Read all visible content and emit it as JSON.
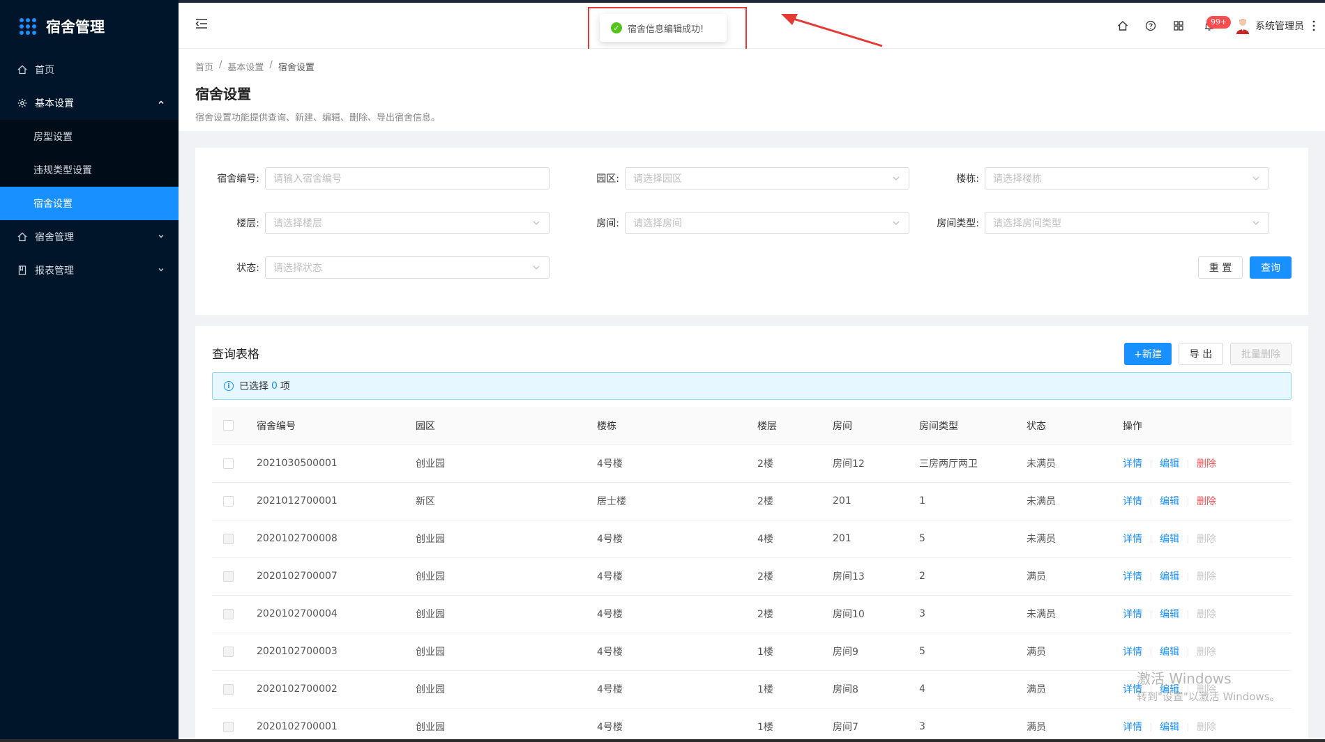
{
  "app": {
    "title": "宿舍管理"
  },
  "sidebar": {
    "items": [
      {
        "label": "首页",
        "icon": "home-icon"
      },
      {
        "label": "基本设置",
        "icon": "gear-icon",
        "open": true,
        "children": [
          {
            "label": "房型设置"
          },
          {
            "label": "违规类型设置"
          },
          {
            "label": "宿舍设置",
            "active": true
          }
        ]
      },
      {
        "label": "宿舍管理",
        "icon": "home-icon"
      },
      {
        "label": "报表管理",
        "icon": "document-icon"
      }
    ]
  },
  "header": {
    "badge": "99+",
    "user": "系统管理员",
    "icons": [
      "home-icon",
      "help-icon",
      "grid-icon",
      "bell-icon",
      "more-icon"
    ]
  },
  "toast": {
    "message": "宿舍信息编辑成功!"
  },
  "page": {
    "breadcrumb": [
      "首页",
      "基本设置",
      "宿舍设置"
    ],
    "breadcrumb_sep": "/",
    "title": "宿舍设置",
    "description": "宿舍设置功能提供查询、新建、编辑、删除、导出宿舍信息。"
  },
  "search": {
    "fields": [
      {
        "label": "宿舍编号:",
        "placeholder": "请输入宿舍编号",
        "type": "input"
      },
      {
        "label": "园区:",
        "placeholder": "请选择园区",
        "type": "select"
      },
      {
        "label": "楼栋:",
        "placeholder": "请选择楼栋",
        "type": "select"
      },
      {
        "label": "楼层:",
        "placeholder": "请选择楼层",
        "type": "select"
      },
      {
        "label": "房间:",
        "placeholder": "请选择房间",
        "type": "select"
      },
      {
        "label": "房间类型:",
        "placeholder": "请选择房间类型",
        "type": "select"
      },
      {
        "label": "状态:",
        "placeholder": "请选择状态",
        "type": "select"
      }
    ],
    "reset_label": "重 置",
    "query_label": "查询"
  },
  "table": {
    "title": "查询表格",
    "new_label": "+新建",
    "export_label": "导 出",
    "batch_delete_label": "批量删除",
    "alert_prefix": "已选择",
    "alert_count": "0",
    "alert_suffix": "项",
    "columns": [
      "宿舍编号",
      "园区",
      "楼栋",
      "楼层",
      "房间",
      "房间类型",
      "状态",
      "操作"
    ],
    "actions": {
      "detail": "详情",
      "edit": "编辑",
      "delete": "删除"
    },
    "rows": [
      {
        "id": "2021030500001",
        "park": "创业园",
        "building": "4号楼",
        "floor": "2楼",
        "room": "房间12",
        "room_type": "三房两厅两卫",
        "status": "未满员",
        "deletable": true
      },
      {
        "id": "2021012700001",
        "park": "新区",
        "building": "居士楼",
        "floor": "2楼",
        "room": "201",
        "room_type": "1",
        "status": "未满员",
        "deletable": true
      },
      {
        "id": "2020102700008",
        "park": "创业园",
        "building": "4号楼",
        "floor": "4楼",
        "room": "201",
        "room_type": "5",
        "status": "未满员",
        "deletable": false
      },
      {
        "id": "2020102700007",
        "park": "创业园",
        "building": "4号楼",
        "floor": "2楼",
        "room": "房间13",
        "room_type": "2",
        "status": "满员",
        "deletable": false
      },
      {
        "id": "2020102700004",
        "park": "创业园",
        "building": "4号楼",
        "floor": "2楼",
        "room": "房间10",
        "room_type": "3",
        "status": "未满员",
        "deletable": false
      },
      {
        "id": "2020102700003",
        "park": "创业园",
        "building": "4号楼",
        "floor": "1楼",
        "room": "房间9",
        "room_type": "5",
        "status": "满员",
        "deletable": false
      },
      {
        "id": "2020102700002",
        "park": "创业园",
        "building": "4号楼",
        "floor": "1楼",
        "room": "房间8",
        "room_type": "4",
        "status": "满员",
        "deletable": false
      },
      {
        "id": "2020102700001",
        "park": "创业园",
        "building": "4号楼",
        "floor": "1楼",
        "room": "房间7",
        "room_type": "3",
        "status": "满员",
        "deletable": false
      }
    ]
  },
  "watermark": {
    "line1": "激活 Windows",
    "line2": "转到\"设置\"以激活 Windows。"
  },
  "colors": {
    "primary": "#1890ff",
    "danger": "#ff4d4f",
    "sidebar": "#001529",
    "success": "#52c41a",
    "annotation": "#e53935"
  }
}
